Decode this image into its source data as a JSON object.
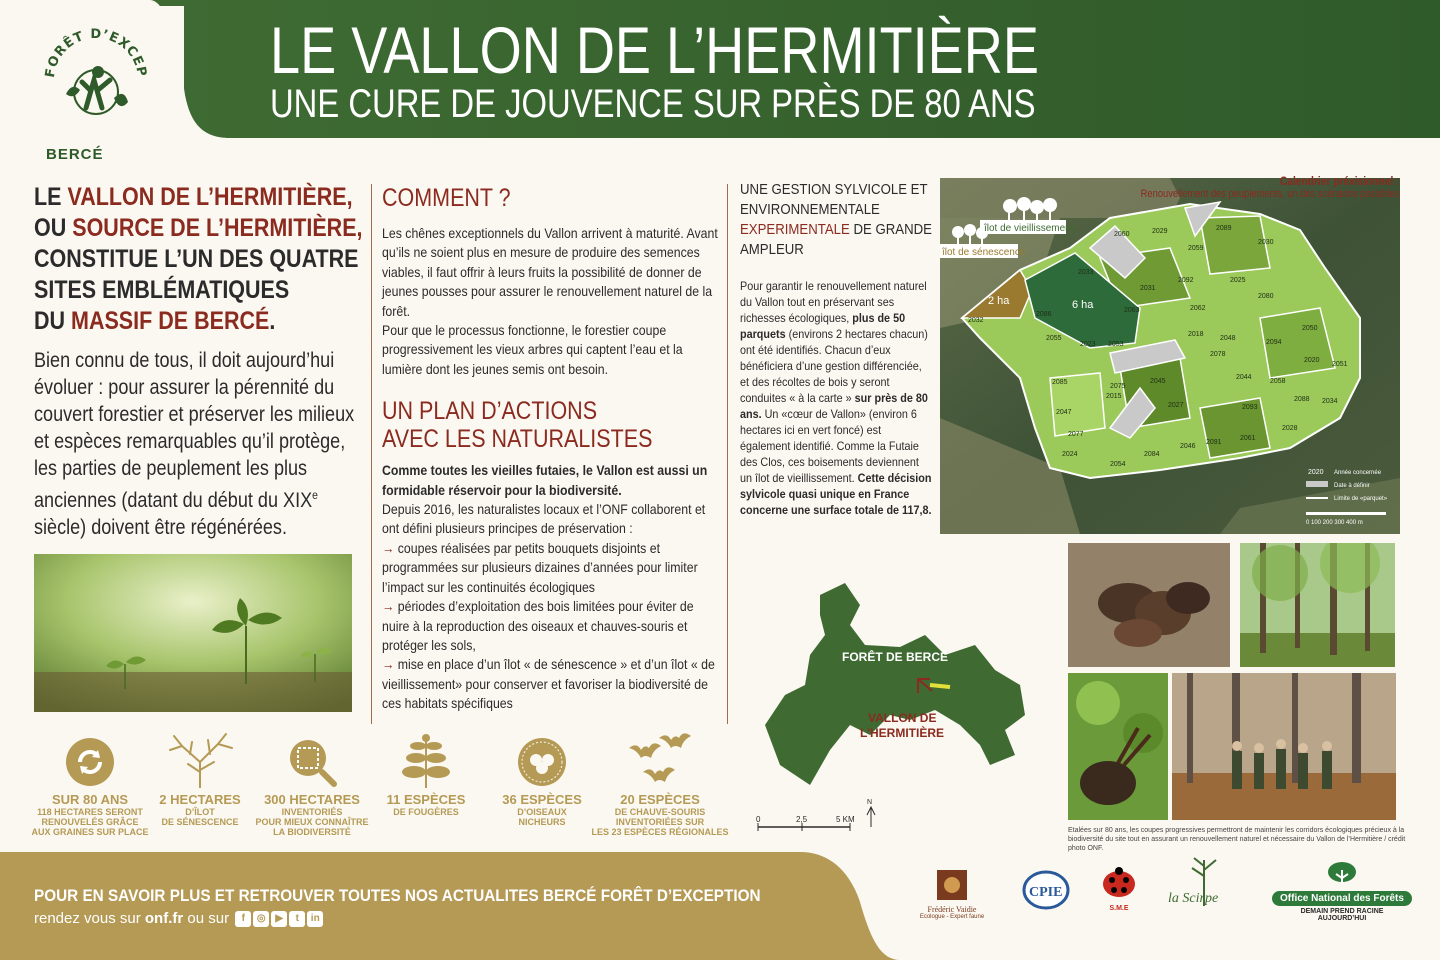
{
  "header": {
    "title": "LE VALLON DE L’HERMITIÈRE",
    "subtitle": "UNE CURE DE JOUVENCE SUR PRÈS DE 80 ANS",
    "logo_text": "FORÊT D’EXCEPTION",
    "logo_place": "BERCÉ"
  },
  "colors": {
    "green": "#3f6b33",
    "dark_green": "#2f5a2a",
    "red": "#8b2a1f",
    "gold": "#b59a55",
    "cream": "#fbf8f1"
  },
  "intro": {
    "l1a": "LE ",
    "l1b": "VALLON DE L’HERMITIÈRE,",
    "l2a": "OU ",
    "l2b": "SOURCE DE L’HERMITIÈRE,",
    "l3": "CONSTITUE L’UN DES QUATRE",
    "l4": "SITES EMBLÉMATIQUES",
    "l5a": "DU ",
    "l5b": "MASSIF DE BERCÉ",
    "l5c": ".",
    "body_a": "Bien connu de tous, il doit aujourd’hui évoluer : pour assurer la pérennité du couvert forestier et préserver les milieux et espèces remarquables qu’il protège, les parties de peuplement les plus anciennes (datant du début du XIX",
    "body_sup": "e",
    "body_b": " siècle) doivent être régénérées."
  },
  "comment": {
    "title": "COMMENT ?",
    "text": "Les chênes exceptionnels du Vallon arrivent à maturité. Avant qu’ils ne soient plus en mesure de produire des semences viables, il faut offrir à leurs fruits la possibilité de donner de jeunes pousses pour assurer le renouvellement naturel de la forêt.",
    "text2": "Pour que le processus fonctionne, le forestier coupe progressivement les vieux arbres qui captent l’eau et la lumière dont les jeunes semis ont besoin."
  },
  "plan": {
    "title1": "UN PLAN D’ACTIONS",
    "title2": "AVEC LES NATURALISTES",
    "lead": "Comme toutes les vieilles futaies, le Vallon est aussi un formidable réservoir pour la biodiversité.",
    "text": "Depuis 2016, les naturalistes locaux et l’ONF collaborent et ont défini plusieurs principes de préservation :",
    "arrow": "→",
    "items": [
      "coupes réalisées par petits bouquets disjoints et programmées sur plusieurs dizaines d’années pour limiter l’impact sur les continuités écologiques",
      "périodes d’exploitation des bois limitées pour éviter de nuire à la reproduction des oiseaux et chauves-souris et protéger les sols,",
      "mise en place d’un îlot « de sénescence » et d’un îlot « de vieillissement» pour conserver et favoriser la biodiversité de ces habitats spécifiques"
    ]
  },
  "gestion": {
    "t1": "UNE GESTION SYLVICOLE ET ENVIRONNEMENTALE ",
    "t2": "EXPERIMENTALE",
    "t3": " DE GRANDE AMPLEUR",
    "p_a": "Pour garantir le renouvellement naturel du Vallon tout en préservant ses richesses écologiques, ",
    "p_b": "plus de 50 parquets",
    "p_c": " (environs 2 hectares chacun) ont été identifiés. Chacun d’eux bénéficiera d’une gestion différenciée, et des récoltes de bois y seront conduites « à la carte » ",
    "p_d": "sur près de 80 ans.",
    "p_e": " Un «cœur de Vallon» (environ 6 hectares ici en vert foncé) est également identifié. Comme la Futaie des Clos, ces boisements deviennent un îlot de vieillissement. ",
    "p_f": "Cette décision sylvicole quasi unique en France concerne une surface totale de 117,8."
  },
  "calendar": {
    "title": "Calendrier prévisionnel :",
    "sub": "Renouvellement des peuplements, un des scénarios possibles"
  },
  "map": {
    "ilot_vieil": "îlot de vieillissement",
    "ilot_sen": "îlot de sénescence",
    "ha2": "2 ha",
    "ha6": "6 ha",
    "legend_year": "2020",
    "legend_year_label": "Année concernée",
    "legend_def": "Date à définir",
    "legend_lim": "Limite de «parquet»",
    "scale": "0   100   200   300   400 m",
    "parcels": [
      "2060",
      "2029",
      "2089",
      "2030",
      "2059",
      "2033",
      "2092",
      "2025",
      "2032",
      "2086",
      "2063",
      "2031",
      "2062",
      "2080",
      "2055",
      "2023",
      "2053",
      "2018",
      "2048",
      "2050",
      "2078",
      "2094",
      "2020",
      "2051",
      "2085",
      "2075",
      "2045",
      "2044",
      "2058",
      "2015",
      "2027",
      "2093",
      "2088",
      "2034",
      "2047",
      "2077",
      "2046",
      "2091",
      "2061",
      "2028",
      "2024",
      "2054",
      "2084"
    ]
  },
  "locator": {
    "forest": "FORÊT DE BERCÉ",
    "vallon1": "VALLON DE",
    "vallon2": "L’HERMITIÈRE",
    "s0": "0",
    "s1": "2,5",
    "s2": "5 KM",
    "north": "N"
  },
  "caption": "Etalées sur 80 ans, les coupes progressives permettront de maintenir les corridors écologiques précieux à la biodiversité du site tout en assurant un renouvellement naturel et nécessaire du Vallon de l’Hermitière / crédit photo ONF.",
  "stats": [
    {
      "big": "SUR 80 ANS",
      "small": "118 HECTARES SERONT\nRENOUVELÉS GRÂCE\nAUX GRAINES SUR PLACE"
    },
    {
      "big": "2 HECTARES",
      "small": "D’ÎLOT\nDE SÉNESCENCE"
    },
    {
      "big": "300 HECTARES",
      "small": "INVENTORIÉS\nPOUR MIEUX CONNAÎTRE\nLA BIODIVERSITÉ"
    },
    {
      "big": "11 ESPÈCES",
      "small": "DE FOUGÈRES"
    },
    {
      "big": "36 ESPÈCES",
      "small": "D’OISEAUX\nNICHEURS"
    },
    {
      "big": "20 ESPÈCES",
      "small": "DE CHAUVE-SOURIS\nINVENTORIÉES SUR\nLES 23 ESPÈCES RÉGIONALES"
    }
  ],
  "footer": {
    "title": "POUR EN SAVOIR PLUS ET RETROUVER TOUTES NOS ACTUALITES BERCÉ FORÊT D’EXCEPTION",
    "sub_a": "rendez vous sur ",
    "sub_b": "onf.fr",
    "sub_c": " ou sur "
  },
  "partners": {
    "vaidie1": "Frédéric Vaidie",
    "vaidie2": "Ecologue - Expert faune",
    "cpie": "CPIE",
    "sme": "S.M.E",
    "scirpe": "la Scirpe",
    "onf1": "Office National des Forêts",
    "onf2": "DEMAIN PREND RACINE",
    "onf3": "AUJOURD’HUI"
  }
}
